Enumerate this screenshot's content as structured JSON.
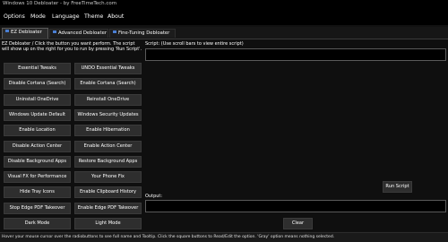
{
  "window": {
    "title": "Windows 10 Debloater - by FreeTimeTech.com"
  },
  "menu": {
    "items": [
      "Options",
      "Mode",
      "Language",
      "Theme",
      "About"
    ]
  },
  "tabs": [
    {
      "label": "EZ Debloater",
      "active": true
    },
    {
      "label": "Advanced Debloater",
      "active": false
    },
    {
      "label": "Fine-Tuning Debloater",
      "active": false
    }
  ],
  "ez": {
    "instructions": "EZ Debloater / Click the button you want perform. The script will show up on the right for you to run by pressing 'Run Script'.",
    "buttons": [
      [
        "Essential Tweaks",
        "UNDO Essential Tweaks"
      ],
      [
        "Disable Cortana (Search)",
        "Enable Cortana (Search)"
      ],
      [
        "Uninstall OneDrive",
        "Reinstall OneDrive"
      ],
      [
        "Windows Update Default",
        "Windows Security Updates"
      ],
      [
        "Enable Location",
        "Enable Hibernation"
      ],
      [
        "Disable Action Center",
        "Enable Action Center"
      ],
      [
        "Disable Background Apps",
        "Restore Background Apps"
      ],
      [
        "Visual FX for Performance",
        "Your Phone Fix"
      ],
      [
        "Hide Tray Icons",
        "Enable Clipboard History"
      ],
      [
        "Stop Edge PDF Takeover",
        "Enable Edge PDF Takeover"
      ],
      [
        "Dark Mode",
        "Light Mode"
      ]
    ],
    "script_label": "Script: (Use scroll bars to view entire script)",
    "run_label": "Run Script",
    "output_label": "Output:",
    "clear_label": "Clear"
  },
  "status": {
    "text": "Hover your mouse cursor over the radiobuttons to see full name and Tooltip. Click the square buttons to Read/Edit the option. 'Gray' option means nothing selected."
  },
  "colors": {
    "background": "#0f0f0f",
    "button": "#2e2e2e",
    "accent": "#4a7fd4"
  }
}
